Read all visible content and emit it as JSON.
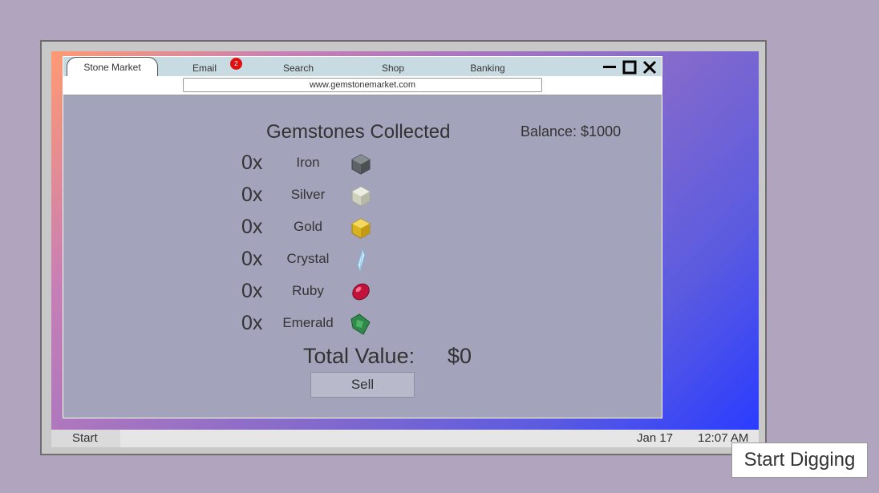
{
  "browser": {
    "tabs": [
      {
        "label": "Stone Market",
        "active": true
      },
      {
        "label": "Email",
        "badge": "2"
      },
      {
        "label": "Search"
      },
      {
        "label": "Shop"
      },
      {
        "label": "Banking"
      }
    ],
    "url": "www.gemstonemarket.com",
    "window_controls": [
      "minimize-icon",
      "maximize-icon",
      "close-icon"
    ]
  },
  "market": {
    "title": "Gemstones Collected",
    "balance": "Balance: $1000",
    "gems": [
      {
        "count": "0x",
        "name": "Iron",
        "icon": "iron-ore-icon",
        "color": "#6f7679"
      },
      {
        "count": "0x",
        "name": "Silver",
        "icon": "silver-ore-icon",
        "color": "#d6d8c8"
      },
      {
        "count": "0x",
        "name": "Gold",
        "icon": "gold-ore-icon",
        "color": "#e1bf2a"
      },
      {
        "count": "0x",
        "name": "Crystal",
        "icon": "crystal-icon",
        "color": "#bfe0f5"
      },
      {
        "count": "0x",
        "name": "Ruby",
        "icon": "ruby-icon",
        "color": "#c0143c"
      },
      {
        "count": "0x",
        "name": "Emerald",
        "icon": "emerald-icon",
        "color": "#2f8a4a"
      }
    ],
    "total_label": "Total Value:",
    "total_value": "$0",
    "sell_label": "Sell"
  },
  "taskbar": {
    "start_label": "Start",
    "date": "Jan 17",
    "time": "12:07 AM"
  },
  "actions": {
    "start_digging_label": "Start Digging"
  },
  "colors": {
    "page_background": "#b0a4bf",
    "browser_background": "#a3a4bc",
    "tab_bar": "#c8dbe3",
    "email_badge": "#e01010"
  }
}
